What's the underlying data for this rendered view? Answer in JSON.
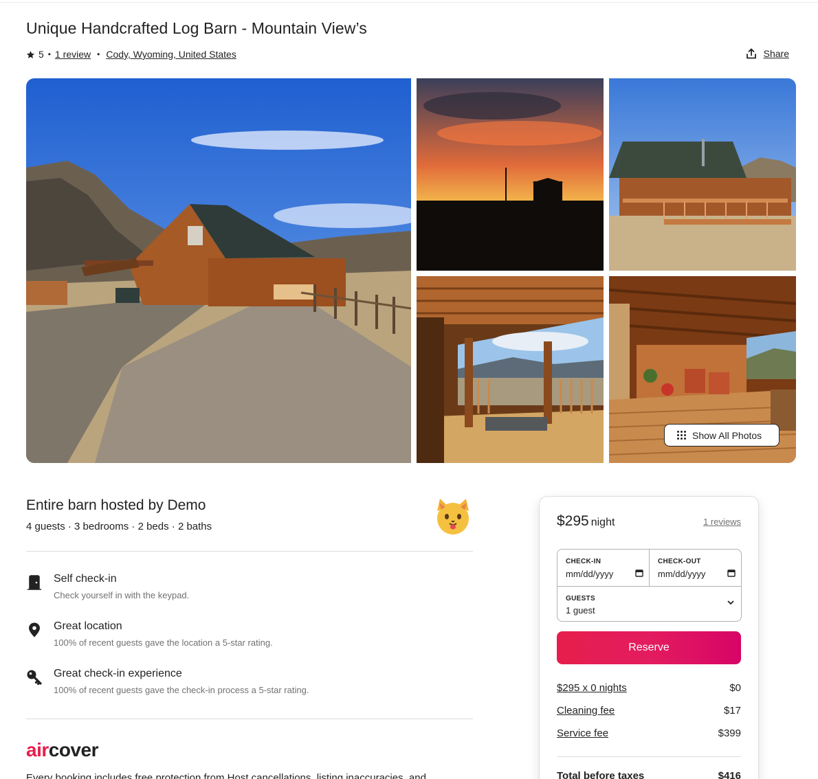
{
  "listing": {
    "title": "Unique Handcrafted Log Barn - Mountain View’s",
    "rating": "5",
    "reviews_link": "1 review",
    "location": "Cody, Wyoming, United States",
    "share_label": "Share"
  },
  "gallery": {
    "show_all_label": "Show All Photos"
  },
  "host": {
    "title": "Entire barn hosted by Demo",
    "details": "4 guests · 3 bedrooms · 2 beds · 2 baths"
  },
  "features": [
    {
      "icon": "door-icon",
      "title": "Self check-in",
      "desc": "Check yourself in with the keypad."
    },
    {
      "icon": "location-pin-icon",
      "title": "Great location",
      "desc": "100% of recent guests gave the location a 5-star rating."
    },
    {
      "icon": "key-icon",
      "title": "Great check-in experience",
      "desc": "100% of recent guests gave the check-in process a 5-star rating."
    }
  ],
  "aircover": {
    "logo_air": "air",
    "logo_cover": "cover",
    "text": "Every booking includes free protection from Host cancellations, listing inaccuracies, and"
  },
  "booking": {
    "price": "$295",
    "per": "night",
    "reviews": "1 reviews",
    "checkin_label": "CHECK-IN",
    "checkin_value": "mm/dd/yyyy",
    "checkout_label": "CHECK-OUT",
    "checkout_value": "mm/dd/yyyy",
    "guests_label": "GUESTS",
    "guests_value": "1 guest",
    "reserve_label": "Reserve",
    "lines": [
      {
        "label": "$295 x 0 nights",
        "value": "$0"
      },
      {
        "label": "Cleaning fee",
        "value": "$17"
      },
      {
        "label": "Service fee",
        "value": "$399"
      }
    ],
    "total_label": "Total before taxes",
    "total_value": "$416"
  },
  "colors": {
    "brand": "#e61e4d",
    "text": "#222222",
    "muted": "#717171"
  }
}
